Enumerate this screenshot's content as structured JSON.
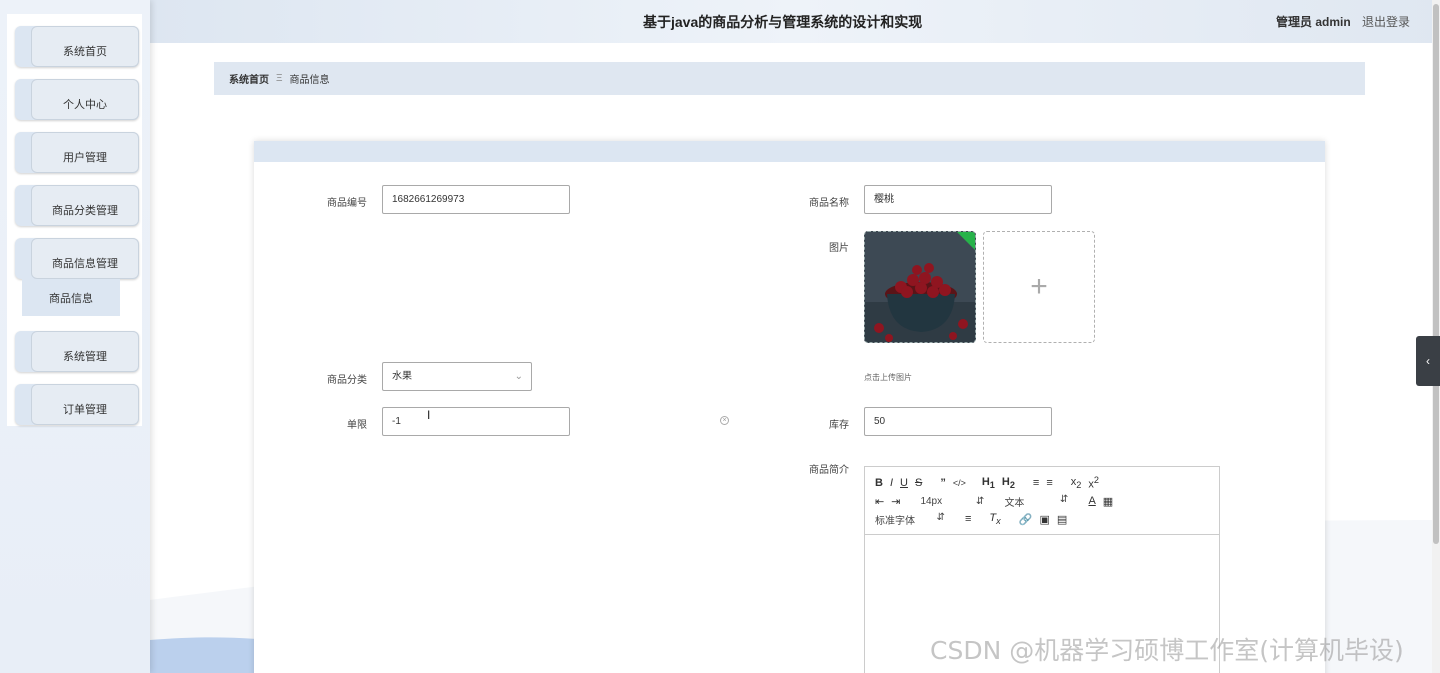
{
  "header": {
    "title": "基于java的商品分析与管理系统的设计和实现",
    "user": "管理员 admin",
    "logout": "退出登录"
  },
  "sidebar": {
    "items": [
      {
        "label": "系统首页"
      },
      {
        "label": "个人中心"
      },
      {
        "label": "用户管理"
      },
      {
        "label": "商品分类管理"
      },
      {
        "label": "商品信息管理"
      },
      {
        "label": "系统管理"
      },
      {
        "label": "订单管理"
      }
    ],
    "submenu": {
      "label": "商品信息"
    }
  },
  "breadcrumb": {
    "home": "系统首页",
    "separator": "Ξ",
    "current": "商品信息"
  },
  "form": {
    "product_no": {
      "label": "商品编号",
      "value": "1682661269973"
    },
    "product_name": {
      "label": "商品名称",
      "value": "樱桃"
    },
    "image": {
      "label": "图片",
      "tip": "点击上传图片",
      "add_icon": "+"
    },
    "category": {
      "label": "商品分类",
      "value": "水果"
    },
    "limit": {
      "label": "单限",
      "value": "-1"
    },
    "stock": {
      "label": "库存",
      "value": "50"
    },
    "description": {
      "label": "商品简介"
    }
  },
  "editor": {
    "font_size": "14px",
    "text_style": "文本",
    "font_family": "标准字体"
  },
  "watermark": "CSDN @机器学习硕博工作室(计算机毕设)",
  "colors": {
    "sidebar_bg": "#edf2f9",
    "menu_bg": "#dce6f2",
    "header_bg": "#dde6f1",
    "accent_green": "#27b24a"
  }
}
